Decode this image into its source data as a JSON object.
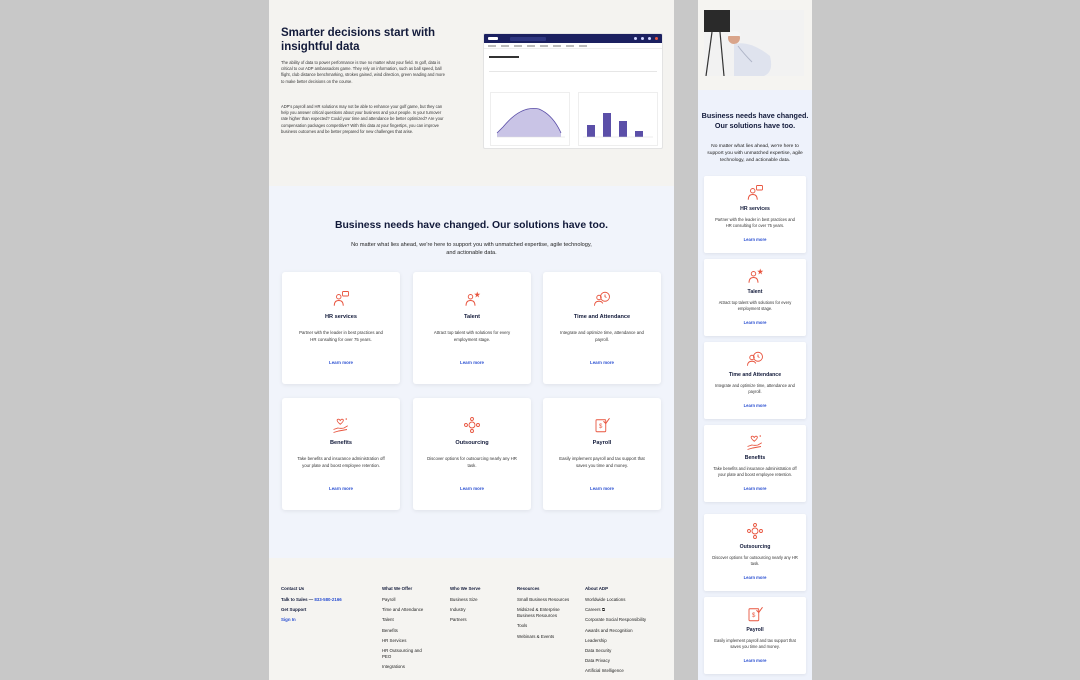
{
  "hero": {
    "title": "Smarter decisions start with insightful data",
    "para1": "The ability of data to power performance is true no matter what your field. In golf, data is critical to our ADP ambassadors game. They rely on information, such as ball speed, ball flight, club distance benchmarking, strokes gained, wind direction, green reading and more to make better decisions on the course.",
    "para2": "ADP's payroll and HR solutions may not be able to enhance your golf game, but they can help you answer critical questions about your business and your people. Is your turnover rate higher than expected? Could your time and attendance be better optimized? Are your compensation packages competitive? With this data at your fingertips, you can improve business outcomes and be better prepared for new challenges that arise."
  },
  "solutions": {
    "heading": "Business needs have changed. Our solutions have too.",
    "subheading": "No matter what lies ahead, we're here to support you with unmatched expertise, agile technology, and actionable data.",
    "cards": [
      {
        "title": "HR services",
        "desc": "Partner with the leader in best practices and HR consulting for over 75 years.",
        "link": "Learn more",
        "icon": "hr-services-icon"
      },
      {
        "title": "Talent",
        "desc": "Attract top talent with solutions for every employment stage.",
        "link": "Learn more",
        "icon": "talent-icon"
      },
      {
        "title": "Time and Attendance",
        "desc": "Integrate and optimize time, attendance and payroll.",
        "link": "Learn more",
        "icon": "clock-icon"
      },
      {
        "title": "Benefits",
        "desc": "Take benefits and insurance administration off your plate and boost employee retention.",
        "link": "Learn more",
        "icon": "benefits-icon"
      },
      {
        "title": "Outsourcing",
        "desc": "Discover options for outsourcing nearly any HR task.",
        "link": "Learn more",
        "icon": "outsourcing-icon"
      },
      {
        "title": "Payroll",
        "desc": "Easily implement payroll and tax support that saves you time and money.",
        "link": "Learn more",
        "icon": "payroll-icon"
      }
    ]
  },
  "mobile": {
    "heading": "Business needs have changed. Our solutions have too.",
    "subheading": "No matter what lies ahead, we're here to support you with unmatched expertise, agile technology, and actionable data."
  },
  "footer": {
    "contact": {
      "heading": "Contact Us",
      "talk": "Talk to Sales — ",
      "phone": "833-580-2166",
      "support": "Get Support",
      "signin": "Sign In"
    },
    "what_we_offer": {
      "heading": "What We Offer",
      "items": [
        "Payroll",
        "Time and Attendance",
        "Talent",
        "Benefits",
        "HR Services",
        "HR Outsourcing and PEO",
        "Integrations"
      ]
    },
    "who_we_serve": {
      "heading": "Who We Serve",
      "items": [
        "Business Size",
        "Industry",
        "Partners"
      ]
    },
    "resources": {
      "heading": "Resources",
      "items": [
        "Small Business Resources",
        "Midsized & Enterprise Business Resources",
        "Tools",
        "Webinars & Events"
      ]
    },
    "about": {
      "heading": "About ADP",
      "items": [
        "Worldwide Locations",
        "Careers ⧉",
        "Corporate Social Responsibility",
        "Awards and Recognition",
        "Leadership",
        "Data Security",
        "Data Privacy",
        "Artificial Intelligence"
      ]
    }
  },
  "colors": {
    "accent": "#e8553f",
    "link": "#2a4fd1",
    "navy": "#121a3a",
    "chart": "#5b4fa8"
  }
}
